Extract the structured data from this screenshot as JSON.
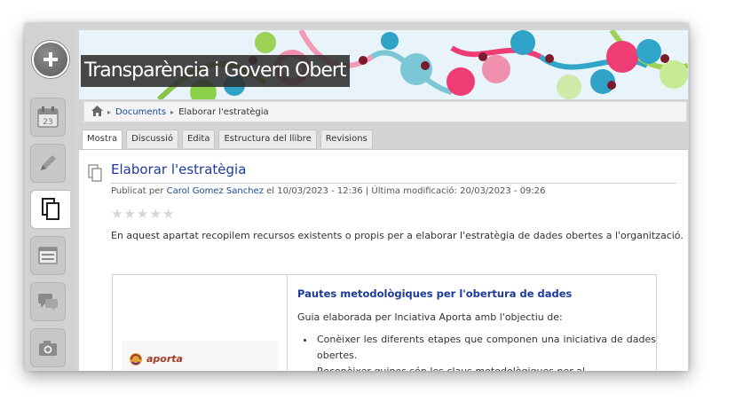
{
  "site": {
    "title": "Transparència i Govern Obert"
  },
  "rail": {
    "items": [
      {
        "icon": "calendar-icon",
        "label": "23"
      },
      {
        "icon": "pencil-icon"
      },
      {
        "icon": "documents-icon"
      },
      {
        "icon": "list-icon"
      },
      {
        "icon": "chat-icon"
      },
      {
        "icon": "camera-icon"
      }
    ]
  },
  "breadcrumb": {
    "link": "Documents",
    "current": "Elaborar l'estratègia"
  },
  "tabs": [
    "Mostra",
    "Discussió",
    "Edita",
    "Estructura del llibre",
    "Revisions"
  ],
  "node": {
    "title": "Elaborar l'estratègia",
    "meta_prefix": "Publicat per",
    "author": "Carol Gomez Sanchez",
    "meta_suffix": "el 10/03/2023 - 12:36 | Última modificació: 20/03/2023 - 09:26",
    "rating_stars": 5,
    "intro": "En aquest apartat recopilem recursos existents o propis per a elaborar l'estratègia de dades obertes a l'organització."
  },
  "resource": {
    "logo_text": "aporta",
    "title": "Pautes metodològiques per l'obertura de dades",
    "description": "Guia elaborada per Inciativa Aporta amb l'objectiu de:",
    "items": [
      "Conèixer les diferents etapes que componen una iniciativa de dades obertes.",
      "Reconèixer quines són les claus metodològiques per al"
    ]
  },
  "colors": {
    "link": "#1a4a99",
    "title": "#1d3a9b",
    "rail": "#d2d2d2"
  }
}
